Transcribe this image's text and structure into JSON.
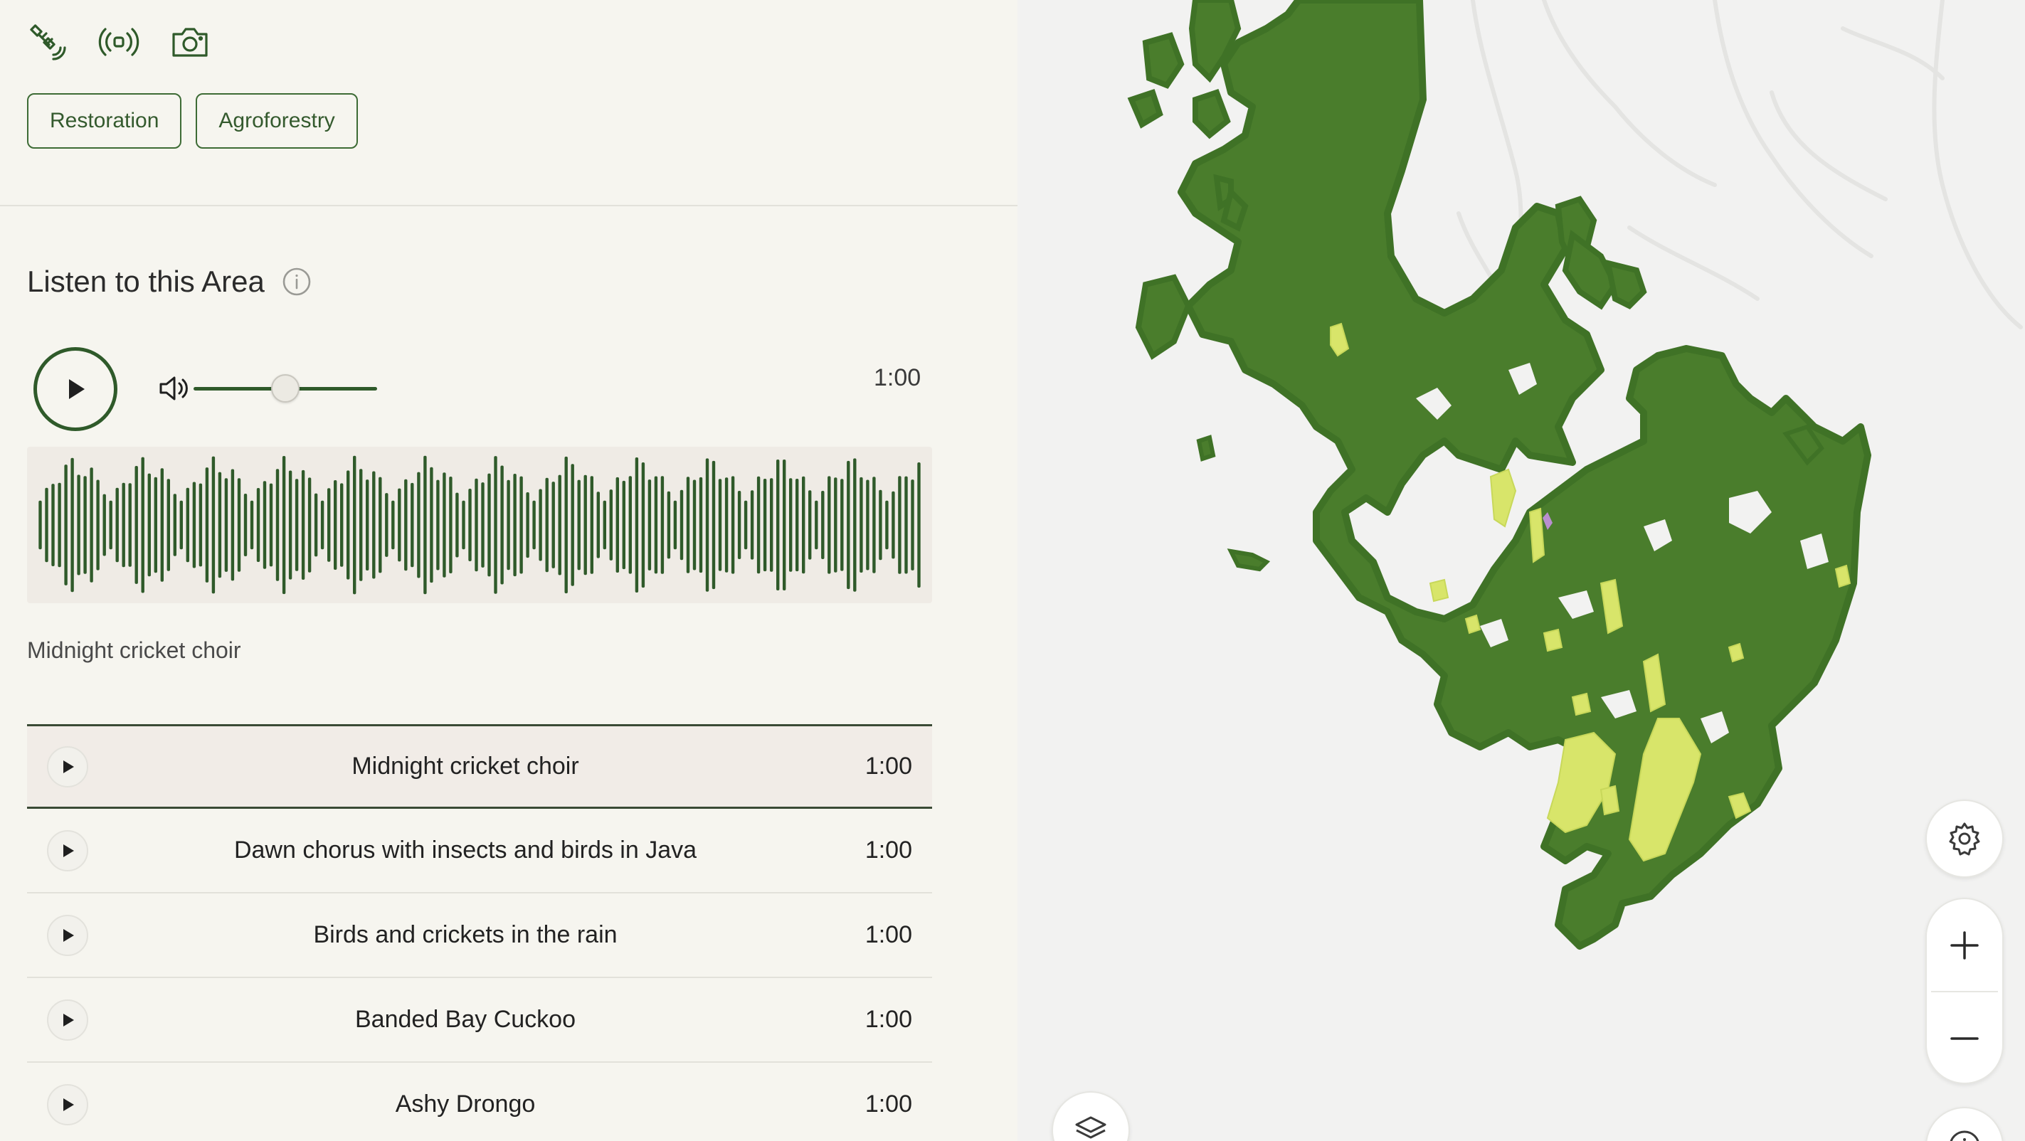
{
  "header": {
    "icons": [
      "satellite-icon",
      "broadcast-icon",
      "camera-icon"
    ]
  },
  "tags": [
    {
      "label": "Restoration"
    },
    {
      "label": "Agroforestry"
    }
  ],
  "listen": {
    "title": "Listen to this Area",
    "info_icon": "info-icon"
  },
  "player": {
    "duration": "1:00",
    "volume_level": 0.5,
    "now_playing": "Midnight cricket choir"
  },
  "tracks": [
    {
      "name": "Midnight cricket choir",
      "duration": "1:00",
      "active": true
    },
    {
      "name": "Dawn chorus with insects and birds in Java",
      "duration": "1:00",
      "active": false
    },
    {
      "name": "Birds and crickets in the rain",
      "duration": "1:00",
      "active": false
    },
    {
      "name": "Banded Bay Cuckoo",
      "duration": "1:00",
      "active": false
    },
    {
      "name": "Ashy Drongo",
      "duration": "1:00",
      "active": false
    }
  ],
  "colors": {
    "accent": "#2f5a2a",
    "forest": "#4a7d2c",
    "forest_edge": "#3f7226",
    "restoration_yellow": "#d8e56a",
    "map_bg": "#f2f2f1"
  },
  "map_controls": [
    "gear-icon",
    "plus-icon",
    "minus-icon",
    "layers-icon",
    "info-icon"
  ]
}
